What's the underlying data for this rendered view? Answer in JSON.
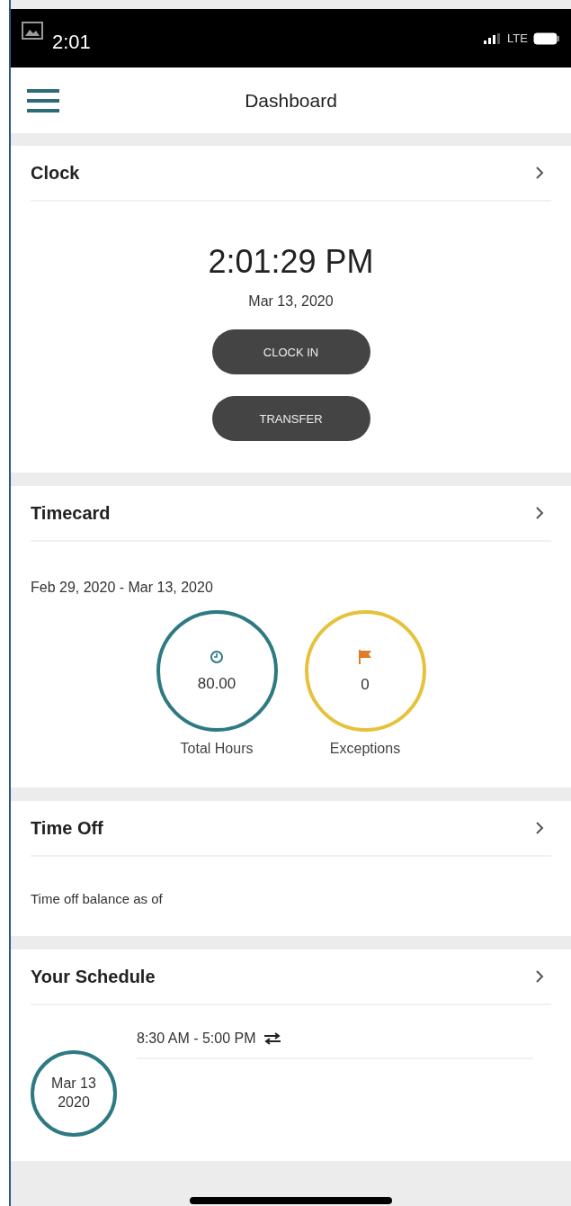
{
  "status_bar": {
    "time": "2:01",
    "network": "LTE"
  },
  "header": {
    "title": "Dashboard"
  },
  "clock": {
    "title": "Clock",
    "time": "2:01:29 PM",
    "date": "Mar 13, 2020",
    "buttons": [
      "CLOCK IN",
      "TRANSFER"
    ]
  },
  "timecard": {
    "title": "Timecard",
    "period": "Feb 29, 2020 - Mar 13, 2020",
    "stats": [
      {
        "kind": "hours",
        "value": "80.00",
        "label": "Total Hours",
        "color": "#2e7a82"
      },
      {
        "kind": "exceptions",
        "value": "0",
        "label": "Exceptions",
        "color": "#e6c23c"
      }
    ]
  },
  "time_off": {
    "title": "Time Off",
    "text": "Time off balance as of"
  },
  "schedule": {
    "title": "Your Schedule",
    "date": [
      "Mar 13",
      "2020"
    ],
    "shifts": [
      {
        "time": "8:30 AM - 5:00 PM"
      }
    ]
  }
}
